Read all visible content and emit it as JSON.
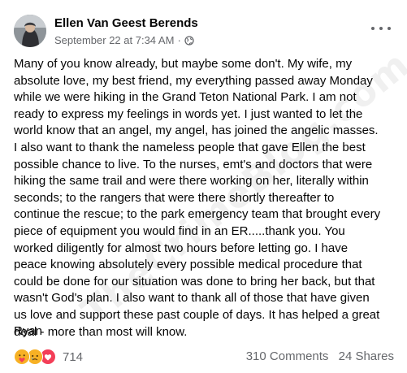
{
  "post": {
    "author": "Ellen Van Geest Berends",
    "date": "September 22 at 7:34 AM",
    "privacy_icon": "globe-icon",
    "menu_icon": "more-options-icon",
    "lines": [
      "Many of you know already, but maybe some don't.  My wife, my",
      "absolute love, my best friend, my everything passed away Monday",
      "while we were hiking in the Grand Teton National Park.  I am not",
      "ready to express my feelings in words yet.  I just wanted to let the",
      "world know that an angel, my angel, has joined the angelic masses.",
      "I also want to thank the nameless people that gave Ellen the best",
      "possible chance to live.  To the nurses, emt's and doctors that were",
      "hiking the same trail and were there working on her, literally within",
      "seconds; to the rangers that were there shortly thereafter to",
      "continue the rescue; to the park emergency team that brought every",
      "piece of equipment you would find in an ER.....thank you.  You",
      "worked diligently for almost two hours before letting go.  I have",
      "peace knowing absolutely every possible medical procedure that",
      "could be done for our situation was done to bring her back, but that",
      "wasn't God's plan.  I also want to thank all of those that have given",
      "us love and support these past couple of days.  It has helped a great",
      "deal - more than most will know."
    ],
    "signature": "Ryan"
  },
  "footer": {
    "reaction_icons": [
      "care-icon",
      "sad-icon",
      "love-icon"
    ],
    "reaction_count": "714",
    "comments": "310 Comments",
    "shares": "24 Shares"
  },
  "watermark": "TheCrimeBlog.com",
  "colors": {
    "text": "#050505",
    "secondary": "#65676b",
    "love": "#f33e58",
    "emoji": "#f7b125"
  }
}
